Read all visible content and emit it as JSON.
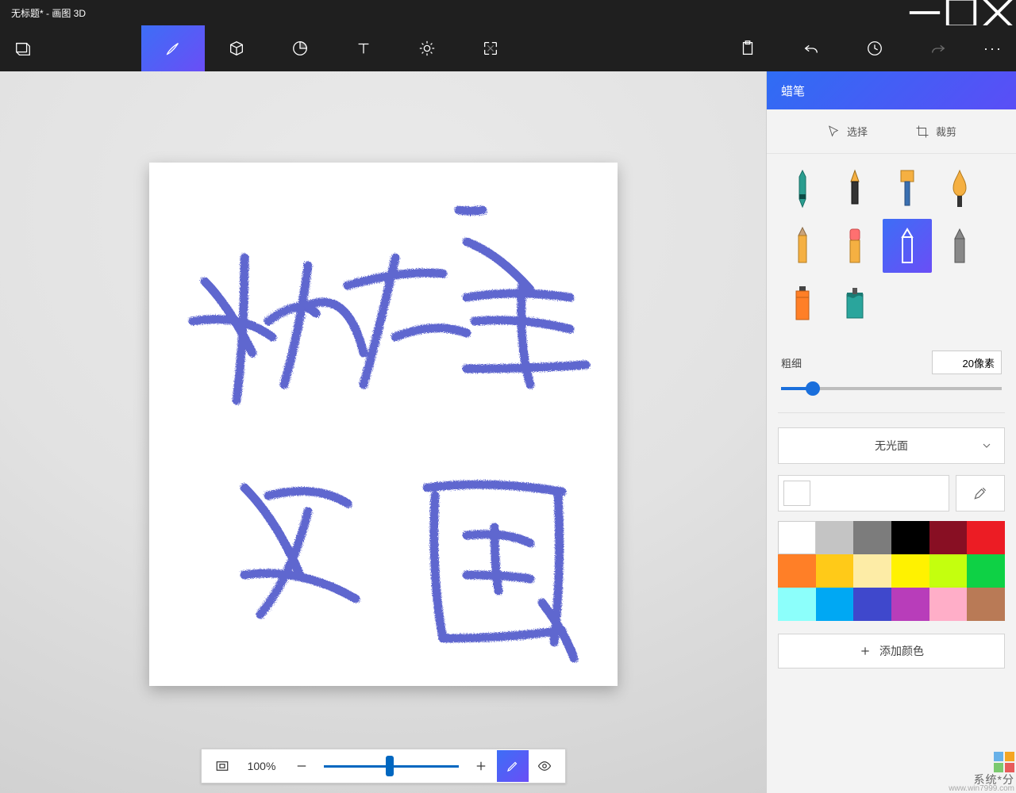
{
  "window": {
    "title": "无标题* - 画图 3D"
  },
  "tools": {
    "menu": "菜单",
    "brushes": "画笔",
    "shapes3d": "3D 形状",
    "stickers": "贴纸",
    "text": "文本",
    "effects": "效果",
    "canvas": "画布",
    "paste": "粘贴",
    "undo": "撤销",
    "history": "历史",
    "redo": "重做",
    "more": "更多"
  },
  "panel": {
    "title": "蜡笔",
    "select": "选择",
    "crop": "裁剪",
    "brushes": [
      "marker",
      "calligraphy",
      "oil",
      "watercolor",
      "pencil",
      "eraser",
      "crayon",
      "pixel",
      "spray",
      "fill"
    ],
    "selected_brush_index": 6,
    "thickness_label": "粗细",
    "thickness_value": "20像素",
    "thickness_percent": 13,
    "material_label": "无光面",
    "palette": [
      "#ffffff",
      "#c4c4c4",
      "#7c7c7c",
      "#000000",
      "#880f23",
      "#ec1c24",
      "#ff7f27",
      "#ffca18",
      "#fdeca6",
      "#fff200",
      "#c4ff0e",
      "#0ed145",
      "#8cfffb",
      "#00a8f3",
      "#3f48cc",
      "#b83dba",
      "#ffaec8",
      "#b97a56"
    ],
    "add_color": "添加颜色"
  },
  "bottombar": {
    "zoom": "100%"
  },
  "watermark": {
    "text": "系统*分",
    "url": "www.win7999.com"
  }
}
